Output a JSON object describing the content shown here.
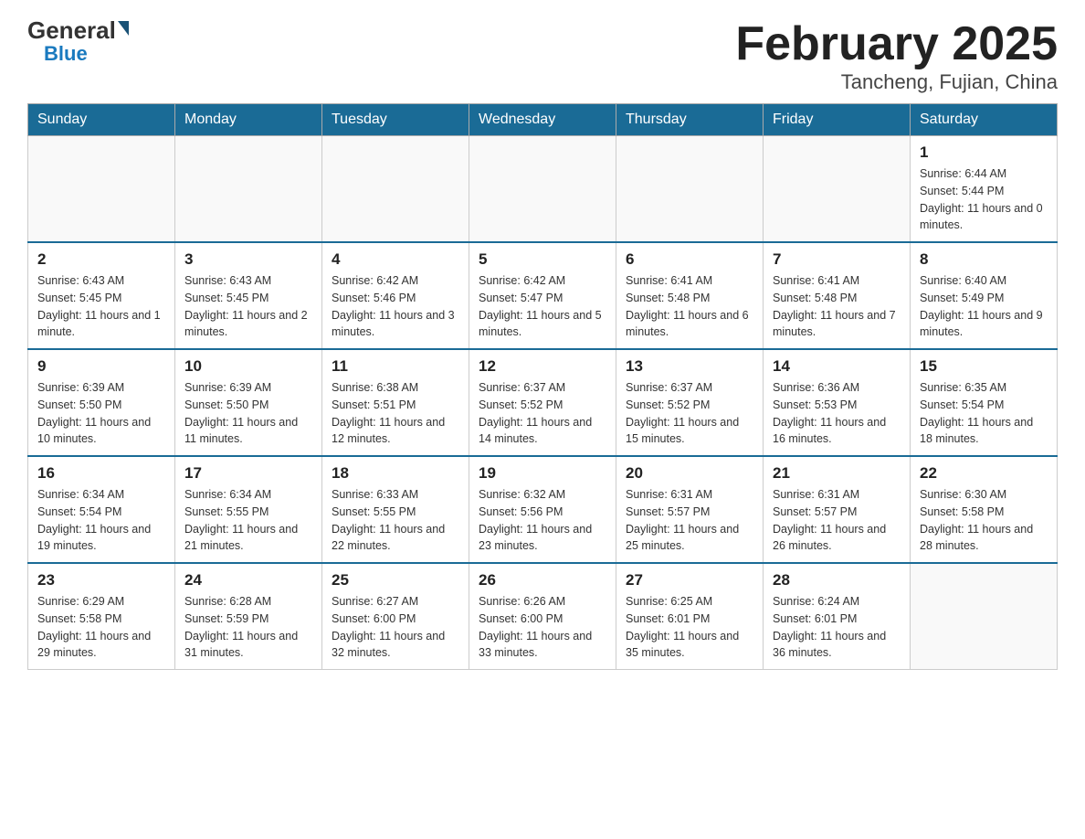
{
  "header": {
    "logo_general": "General",
    "logo_blue": "Blue",
    "title": "February 2025",
    "subtitle": "Tancheng, Fujian, China"
  },
  "weekdays": [
    "Sunday",
    "Monday",
    "Tuesday",
    "Wednesday",
    "Thursday",
    "Friday",
    "Saturday"
  ],
  "weeks": [
    [
      {
        "day": "",
        "info": ""
      },
      {
        "day": "",
        "info": ""
      },
      {
        "day": "",
        "info": ""
      },
      {
        "day": "",
        "info": ""
      },
      {
        "day": "",
        "info": ""
      },
      {
        "day": "",
        "info": ""
      },
      {
        "day": "1",
        "info": "Sunrise: 6:44 AM\nSunset: 5:44 PM\nDaylight: 11 hours and 0 minutes."
      }
    ],
    [
      {
        "day": "2",
        "info": "Sunrise: 6:43 AM\nSunset: 5:45 PM\nDaylight: 11 hours and 1 minute."
      },
      {
        "day": "3",
        "info": "Sunrise: 6:43 AM\nSunset: 5:45 PM\nDaylight: 11 hours and 2 minutes."
      },
      {
        "day": "4",
        "info": "Sunrise: 6:42 AM\nSunset: 5:46 PM\nDaylight: 11 hours and 3 minutes."
      },
      {
        "day": "5",
        "info": "Sunrise: 6:42 AM\nSunset: 5:47 PM\nDaylight: 11 hours and 5 minutes."
      },
      {
        "day": "6",
        "info": "Sunrise: 6:41 AM\nSunset: 5:48 PM\nDaylight: 11 hours and 6 minutes."
      },
      {
        "day": "7",
        "info": "Sunrise: 6:41 AM\nSunset: 5:48 PM\nDaylight: 11 hours and 7 minutes."
      },
      {
        "day": "8",
        "info": "Sunrise: 6:40 AM\nSunset: 5:49 PM\nDaylight: 11 hours and 9 minutes."
      }
    ],
    [
      {
        "day": "9",
        "info": "Sunrise: 6:39 AM\nSunset: 5:50 PM\nDaylight: 11 hours and 10 minutes."
      },
      {
        "day": "10",
        "info": "Sunrise: 6:39 AM\nSunset: 5:50 PM\nDaylight: 11 hours and 11 minutes."
      },
      {
        "day": "11",
        "info": "Sunrise: 6:38 AM\nSunset: 5:51 PM\nDaylight: 11 hours and 12 minutes."
      },
      {
        "day": "12",
        "info": "Sunrise: 6:37 AM\nSunset: 5:52 PM\nDaylight: 11 hours and 14 minutes."
      },
      {
        "day": "13",
        "info": "Sunrise: 6:37 AM\nSunset: 5:52 PM\nDaylight: 11 hours and 15 minutes."
      },
      {
        "day": "14",
        "info": "Sunrise: 6:36 AM\nSunset: 5:53 PM\nDaylight: 11 hours and 16 minutes."
      },
      {
        "day": "15",
        "info": "Sunrise: 6:35 AM\nSunset: 5:54 PM\nDaylight: 11 hours and 18 minutes."
      }
    ],
    [
      {
        "day": "16",
        "info": "Sunrise: 6:34 AM\nSunset: 5:54 PM\nDaylight: 11 hours and 19 minutes."
      },
      {
        "day": "17",
        "info": "Sunrise: 6:34 AM\nSunset: 5:55 PM\nDaylight: 11 hours and 21 minutes."
      },
      {
        "day": "18",
        "info": "Sunrise: 6:33 AM\nSunset: 5:55 PM\nDaylight: 11 hours and 22 minutes."
      },
      {
        "day": "19",
        "info": "Sunrise: 6:32 AM\nSunset: 5:56 PM\nDaylight: 11 hours and 23 minutes."
      },
      {
        "day": "20",
        "info": "Sunrise: 6:31 AM\nSunset: 5:57 PM\nDaylight: 11 hours and 25 minutes."
      },
      {
        "day": "21",
        "info": "Sunrise: 6:31 AM\nSunset: 5:57 PM\nDaylight: 11 hours and 26 minutes."
      },
      {
        "day": "22",
        "info": "Sunrise: 6:30 AM\nSunset: 5:58 PM\nDaylight: 11 hours and 28 minutes."
      }
    ],
    [
      {
        "day": "23",
        "info": "Sunrise: 6:29 AM\nSunset: 5:58 PM\nDaylight: 11 hours and 29 minutes."
      },
      {
        "day": "24",
        "info": "Sunrise: 6:28 AM\nSunset: 5:59 PM\nDaylight: 11 hours and 31 minutes."
      },
      {
        "day": "25",
        "info": "Sunrise: 6:27 AM\nSunset: 6:00 PM\nDaylight: 11 hours and 32 minutes."
      },
      {
        "day": "26",
        "info": "Sunrise: 6:26 AM\nSunset: 6:00 PM\nDaylight: 11 hours and 33 minutes."
      },
      {
        "day": "27",
        "info": "Sunrise: 6:25 AM\nSunset: 6:01 PM\nDaylight: 11 hours and 35 minutes."
      },
      {
        "day": "28",
        "info": "Sunrise: 6:24 AM\nSunset: 6:01 PM\nDaylight: 11 hours and 36 minutes."
      },
      {
        "day": "",
        "info": ""
      }
    ]
  ]
}
